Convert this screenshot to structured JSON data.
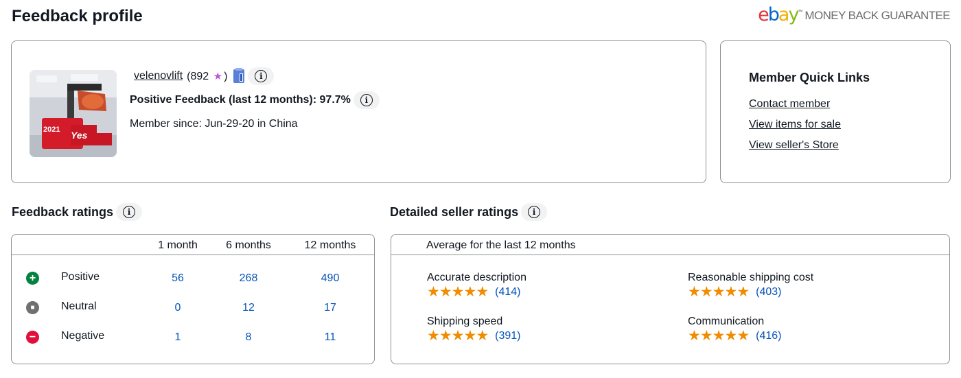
{
  "page": {
    "title": "Feedback profile"
  },
  "guarantee": {
    "logo_text": "ebay",
    "text": "MONEY BACK GUARANTEE"
  },
  "profile": {
    "username": "velenovlift",
    "score_open": "(892",
    "score_close": ")",
    "star": "★",
    "positive_feedback": "Positive Feedback (last 12 months): 97.7%",
    "member_since": "Member since: Jun-29-20 in China",
    "avatar_texts": [
      "2021",
      "Yes"
    ]
  },
  "quick_links": {
    "title": "Member Quick Links",
    "items": [
      "Contact member",
      "View items for sale",
      "View seller's Store"
    ]
  },
  "feedback_ratings": {
    "title": "Feedback ratings",
    "columns": [
      "1 month",
      "6 months",
      "12 months"
    ],
    "rows": [
      {
        "label": "Positive",
        "icon": "plus-icon",
        "color": "#05823f",
        "symbol": "+",
        "values": [
          "56",
          "268",
          "490"
        ]
      },
      {
        "label": "Neutral",
        "icon": "minus-square-icon",
        "color": "#707070",
        "symbol": "■",
        "values": [
          "0",
          "12",
          "17"
        ]
      },
      {
        "label": "Negative",
        "icon": "minus-icon",
        "color": "#e0103a",
        "symbol": "−",
        "values": [
          "1",
          "8",
          "11"
        ]
      }
    ]
  },
  "detailed_ratings": {
    "title": "Detailed seller ratings",
    "subtitle": "Average for the last 12 months",
    "items": [
      {
        "label": "Accurate description",
        "stars": 5,
        "count": "(414)"
      },
      {
        "label": "Reasonable shipping cost",
        "stars": 5,
        "count": "(403)"
      },
      {
        "label": "Shipping speed",
        "stars": 5,
        "count": "(391)"
      },
      {
        "label": "Communication",
        "stars": 5,
        "count": "(416)"
      }
    ]
  },
  "colors": {
    "link_blue": "#0654ba",
    "star_orange": "#f08c00",
    "star_purple": "#b855d9"
  }
}
